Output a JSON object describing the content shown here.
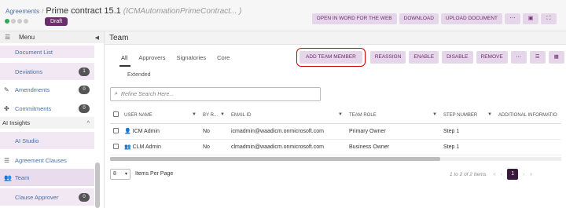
{
  "header": {
    "breadcrumb": "Agreements",
    "separator": "/",
    "title": "Prime contract 15.1",
    "subtitle": "(ICMAutomationPrimeContract... )",
    "status_badge": "Draft",
    "status_dot_colors": [
      "#33a852",
      "#cccccc",
      "#cccccc",
      "#cccccc"
    ],
    "actions": [
      "OPEN IN WORD FOR THE WEB",
      "DOWNLOAD",
      "UPLOAD DOCUMENT",
      "⋯",
      "▣",
      "⛶"
    ]
  },
  "sidebar": {
    "menu_label": "Menu",
    "items": [
      {
        "label": "Document List"
      },
      {
        "label": "Deviations",
        "count": "1"
      },
      {
        "label": "Amendments",
        "count": "0"
      },
      {
        "label": "Commitments",
        "count": "0"
      },
      {
        "label": "AI Insights"
      },
      {
        "label": "AI Studio"
      },
      {
        "label": "Agreement Clauses"
      },
      {
        "label": "Team"
      },
      {
        "label": "Clause Approver",
        "count": "0"
      }
    ]
  },
  "main": {
    "title": "Team",
    "tabs": [
      "All",
      "Approvers",
      "Signatories",
      "Core"
    ],
    "tab_extra": "Extended",
    "action_buttons": [
      "ADD TEAM MEMBER",
      "REASSIGN",
      "ENABLE",
      "DISABLE",
      "REMOVE"
    ],
    "search_placeholder": "Refine Search Here...",
    "columns": [
      "USER NAME",
      "BY R...",
      "EMAIL ID",
      "TEAM ROLE",
      "STEP NUMBER",
      "ADDITIONAL INFORMATIO"
    ],
    "rows": [
      {
        "user": "ICM Admin",
        "by": "No",
        "email": "icmadmin@waadicm.onmicrosoft.com",
        "role": "Primary Owner",
        "step": "Step 1"
      },
      {
        "user": "CLM Admin",
        "by": "No",
        "email": "clmadmin@waadicm.onmicrosoft.com",
        "role": "Business Owner",
        "step": "Step 1"
      }
    ],
    "pager": {
      "page_size": "8",
      "page_size_label": "Items Per Page",
      "info": "1 to 2 of 2 Items",
      "current_page": "1"
    }
  }
}
